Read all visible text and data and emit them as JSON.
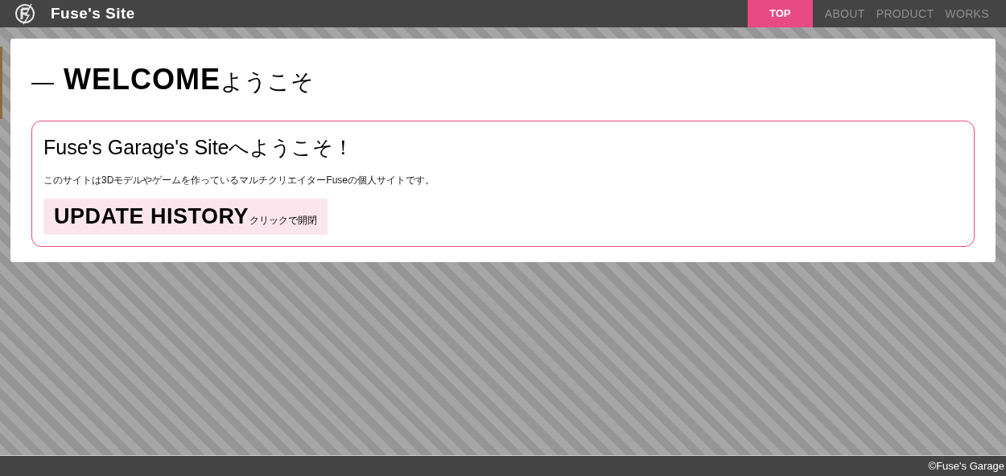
{
  "header": {
    "site_title": "Fuse's Site"
  },
  "nav": [
    {
      "label": "TOP",
      "selected": true
    },
    {
      "label": "ABOUT",
      "selected": false
    },
    {
      "label": "PRODUCT",
      "selected": false
    },
    {
      "label": "WORKS",
      "selected": false
    }
  ],
  "section": {
    "dash": "—",
    "title": "WELCOME",
    "subtitle": "ようこそ"
  },
  "welcome_box": {
    "heading": "Fuse's Garage's Siteへようこそ！",
    "text": "このサイトは3Dモデルやゲームを作っているマルチクリエイターFuseの個人サイトです。",
    "update_history": {
      "title": "UPDATE HISTORY",
      "hint": "クリックで開閉",
      "expanded": false
    }
  },
  "footer": {
    "copyright": "©Fuse's Garage"
  }
}
